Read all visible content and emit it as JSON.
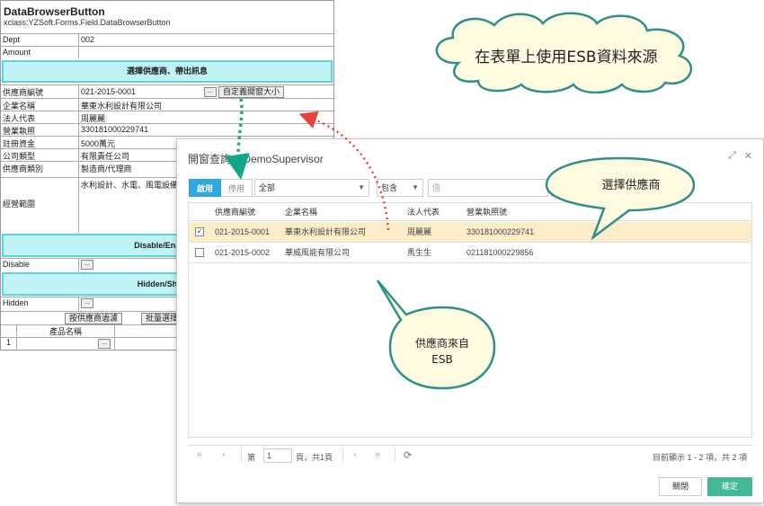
{
  "form": {
    "title": "DataBrowserButton",
    "subtitle": "xclass:YZSoft.Forms.Field.DataBrowserButton",
    "dept_label": "Dept",
    "dept_value": "002",
    "amount_label": "Amount",
    "band1": "選擇供應商、帶出訊息",
    "rows": [
      {
        "label": "供應商編號",
        "value": "021-2015-0001"
      },
      {
        "label": "企業名稱",
        "value": "華東水利設計有限公司"
      },
      {
        "label": "法人代表",
        "value": "周麗麗"
      },
      {
        "label": "營業執照",
        "value": "330181000229741"
      },
      {
        "label": "註冊資金",
        "value": "5000萬元"
      },
      {
        "label": "公司類型",
        "value": "有限責任公司"
      },
      {
        "label": "供應商類別",
        "value": "製造商/代理商"
      },
      {
        "label": "經營範圍",
        "value": "水利設計、水電、風電設備生"
      }
    ],
    "browse_btn": "...",
    "custom_size_btn": "自定義開窗大小",
    "band2": "Disable/Enable(A",
    "disable_label": "Disable",
    "band3": "Hidden/Show(A",
    "hidden_label": "Hidden",
    "filter_btn": "按供應商過濾",
    "batch_btn": "批量選擇",
    "product_header": "產品名稱",
    "product_row_no": "1"
  },
  "cloud_text": "在表單上使用ESB資料來源",
  "dialog": {
    "title": "開窗查詢 - iDemoSupervisor",
    "expand_icon": "expand-icon",
    "close_icon": "close-icon",
    "tab_enabled": "啟用",
    "tab_disabled": "停用",
    "field_select": "全部",
    "op_select": "包含",
    "value_placeholder": "值",
    "minus_btn": "-",
    "plus_btn": "+",
    "columns": [
      "供應商編號",
      "企業名稱",
      "法人代表",
      "營業執照號"
    ],
    "rows": [
      {
        "checked": true,
        "id": "021-2015-0001",
        "name": "華東水利設計有限公司",
        "rep": "周麗麗",
        "license": "330181000229741"
      },
      {
        "checked": false,
        "id": "021-2015-0002",
        "name": "華威風能有限公司",
        "rep": "馬生生",
        "license": "021181000229856"
      }
    ],
    "pager": {
      "page_prefix": "第",
      "page_value": "1",
      "page_suffix": "頁，共1頁",
      "summary": "目前顯示 1 - 2 項，共 2 項"
    },
    "close_btn": "關閉",
    "ok_btn": "確定"
  },
  "bubble_select": "選擇供應商",
  "bubble_esb_line1": "供應商來自",
  "bubble_esb_line2": "ESB",
  "colors": {
    "band_fill": "#bff3f5",
    "band_border": "#5fd3db",
    "accent_blue": "#2fa7e0",
    "ok_green": "#44b99a",
    "selected_row": "#fbedc8",
    "arrow_teal": "#11a88a",
    "arrow_red": "#e8413a",
    "bubble_fill": "#fffbe0",
    "bubble_stroke": "#2f8f8a"
  }
}
